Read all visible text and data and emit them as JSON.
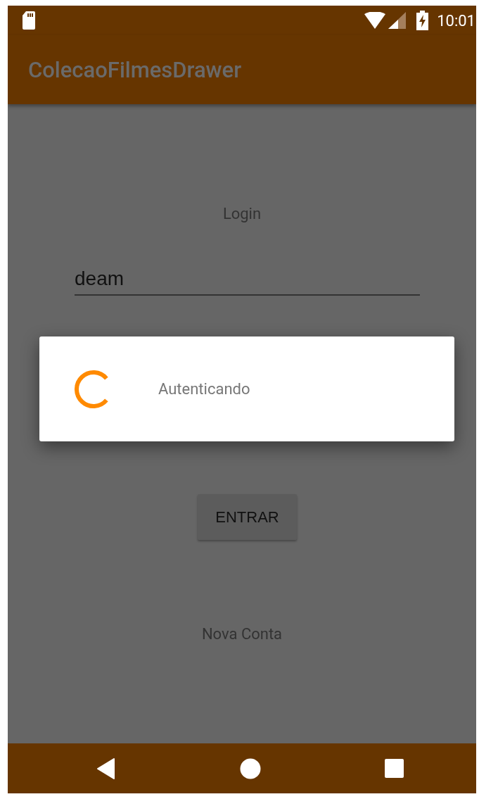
{
  "status_bar": {
    "time": "10:01"
  },
  "app_bar": {
    "title": "ColecaoFilmesDrawer"
  },
  "login": {
    "label": "Login",
    "username": {
      "value": "deam"
    },
    "button": "ENTRAR",
    "link": "Nova Conta"
  },
  "dialog": {
    "message": "Autenticando"
  }
}
